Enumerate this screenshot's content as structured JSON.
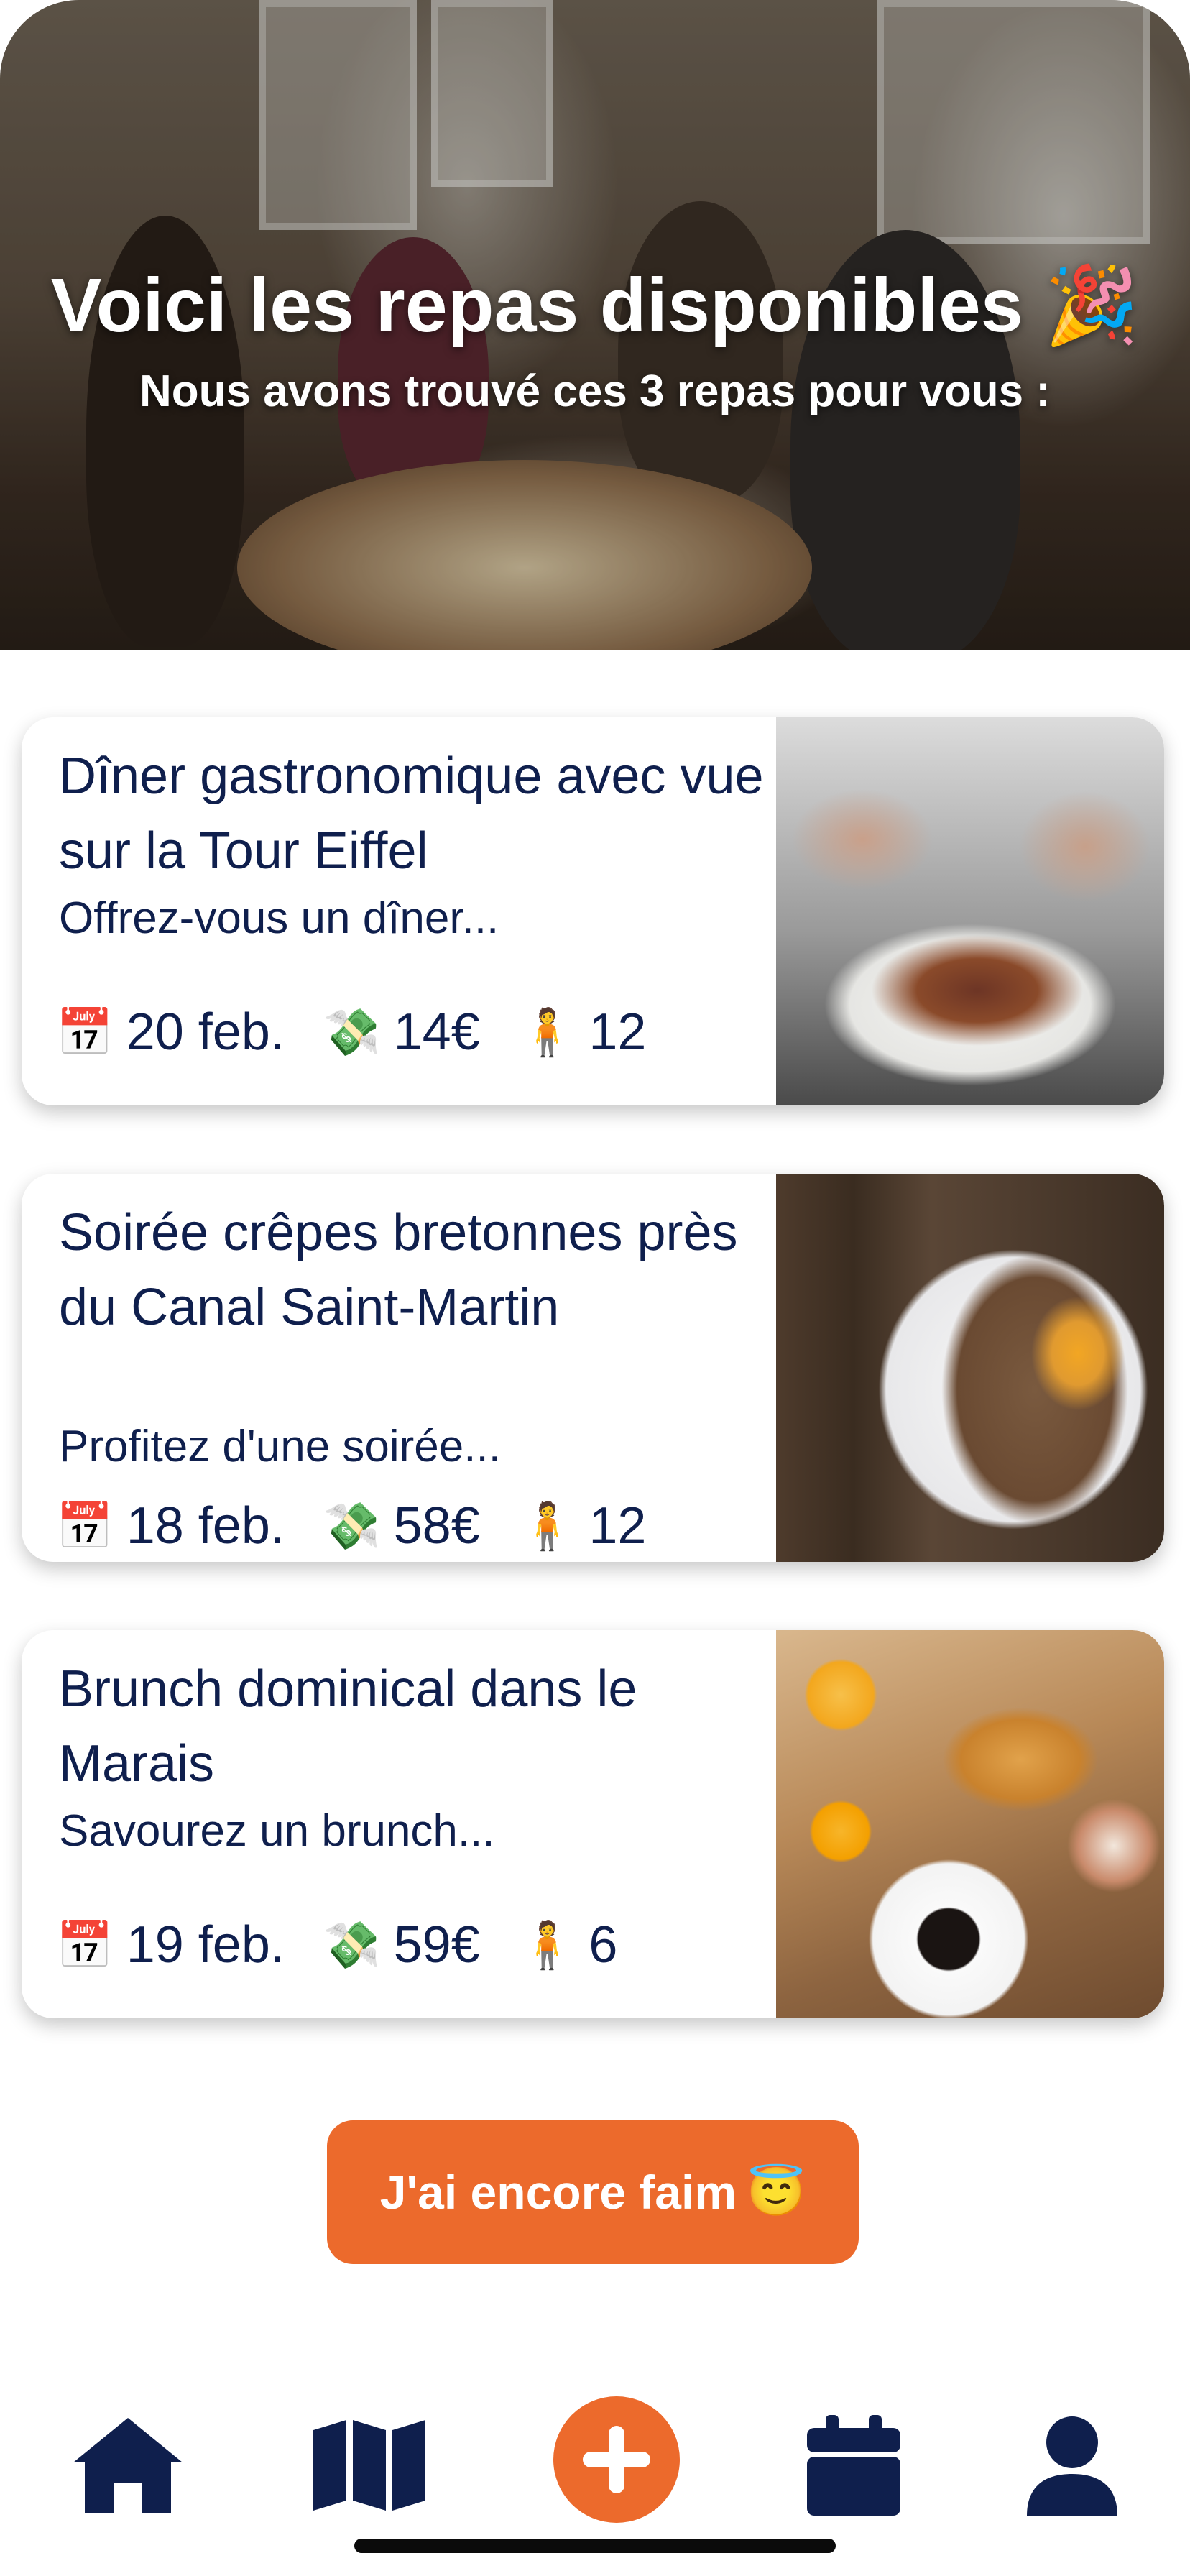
{
  "hero": {
    "title": "Voici les repas disponibles",
    "title_emoji": "🎉",
    "subtitle": "Nous avons trouvé ces 3 repas pour vous :"
  },
  "meals": [
    {
      "title": "Dîner gastronomique avec vue sur la Tour Eiffel",
      "description": "Offrez-vous un dîner...",
      "date": "20 feb.",
      "price": "14€",
      "guests": "12",
      "image": "plated-dish"
    },
    {
      "title": "Soirée crêpes bretonnes près du Canal Saint-Martin",
      "description": "Profitez d'une soirée...",
      "date": "18 feb.",
      "price": "58€",
      "guests": "12",
      "image": "buckwheat-crepe"
    },
    {
      "title": "Brunch dominical dans le Marais",
      "description": "Savourez un brunch...",
      "date": "19 feb.",
      "price": "59€",
      "guests": "6",
      "image": "brunch-spread"
    }
  ],
  "icons": {
    "calendar": "📅",
    "money": "💸",
    "person": "🧍"
  },
  "cta": {
    "label": "J'ai encore faim",
    "emoji": "😇"
  },
  "nav": {
    "items": [
      "home-icon",
      "map-icon",
      "add-icon",
      "calendar-icon",
      "profile-icon"
    ]
  },
  "colors": {
    "accent": "#ec6a2c",
    "navy": "#0f1f4d"
  }
}
